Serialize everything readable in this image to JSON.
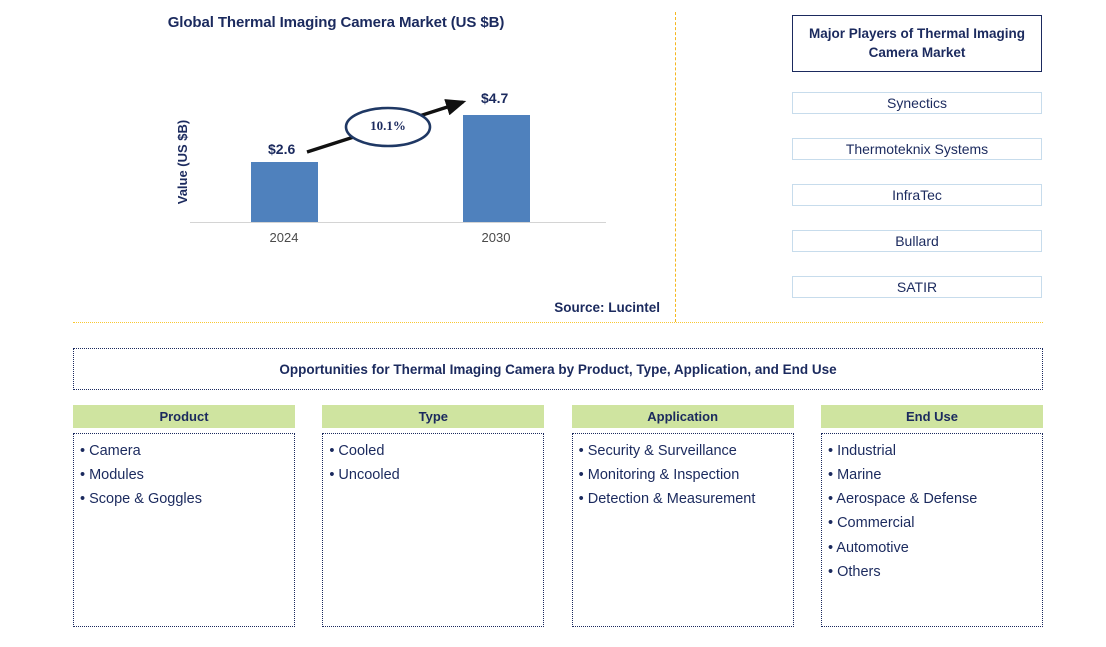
{
  "chart": {
    "title": "Global Thermal Imaging Camera Market (US $B)",
    "y_axis_label": "Value (US $B)",
    "cagr_label": "10.1%",
    "source": "Source: Lucintel"
  },
  "chart_data": {
    "type": "bar",
    "title": "Global Thermal Imaging Camera Market (US $B)",
    "xlabel": "",
    "ylabel": "Value (US $B)",
    "categories": [
      "2024",
      "2030"
    ],
    "values": [
      2.6,
      4.7
    ],
    "data_labels": [
      "$2.6",
      "$4.7"
    ],
    "ylim": [
      0,
      5.6
    ],
    "grid": false,
    "legend": "none",
    "bar_color": "#4f81bd",
    "annotations": [
      {
        "text": "10.1%",
        "kind": "cagr-ellipse-on-arrow",
        "from": "2024",
        "to": "2030"
      }
    ]
  },
  "players": {
    "header": "Major Players of Thermal Imaging Camera Market",
    "items": [
      "Synectics",
      "Thermoteknix Systems",
      "InfraTec",
      "Bullard",
      "SATIR"
    ]
  },
  "opportunities": {
    "banner": "Opportunities for Thermal Imaging Camera by Product, Type, Application, and End Use",
    "columns": [
      {
        "header": "Product",
        "items": [
          "Camera",
          "Modules",
          "Scope & Goggles"
        ]
      },
      {
        "header": "Type",
        "items": [
          "Cooled",
          "Uncooled"
        ]
      },
      {
        "header": "Application",
        "items": [
          "Security & Surveillance",
          "Monitoring & Inspection",
          "Detection & Measurement"
        ]
      },
      {
        "header": "End Use",
        "items": [
          "Industrial",
          "Marine",
          "Aerospace & Defense",
          "Commercial",
          "Automotive",
          "Others"
        ]
      }
    ]
  },
  "colors": {
    "bar": "#4f81bd",
    "navy": "#1b2a5e",
    "green_header": "#cfe4a0",
    "divider_gold": "#fac832",
    "player_border": "#c7dcec"
  }
}
